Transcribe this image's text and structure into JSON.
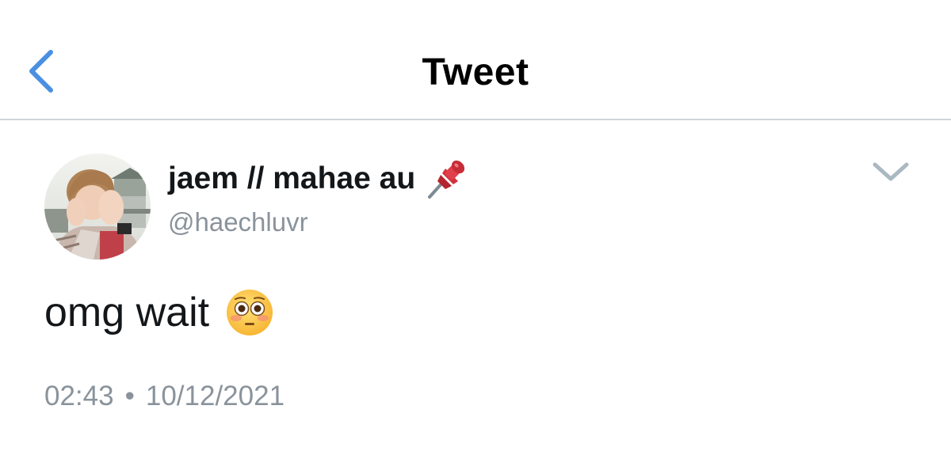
{
  "header": {
    "title": "Tweet",
    "back_icon": "chevron-left-icon",
    "accent_color": "#4a90e2"
  },
  "tweet": {
    "author": {
      "display_name": "jaem // mahae au",
      "name_icon": "pushpin-icon",
      "handle": "@haechluvr",
      "avatar": "avatar"
    },
    "menu_icon": "chevron-down-icon",
    "text": "omg wait",
    "text_emoji": "flushed-face-emoji",
    "time": "02:43",
    "separator": "•",
    "date": "10/12/2021"
  },
  "colors": {
    "text_primary": "#14171a",
    "text_secondary": "#8a939c",
    "divider": "#cfd4d8"
  }
}
